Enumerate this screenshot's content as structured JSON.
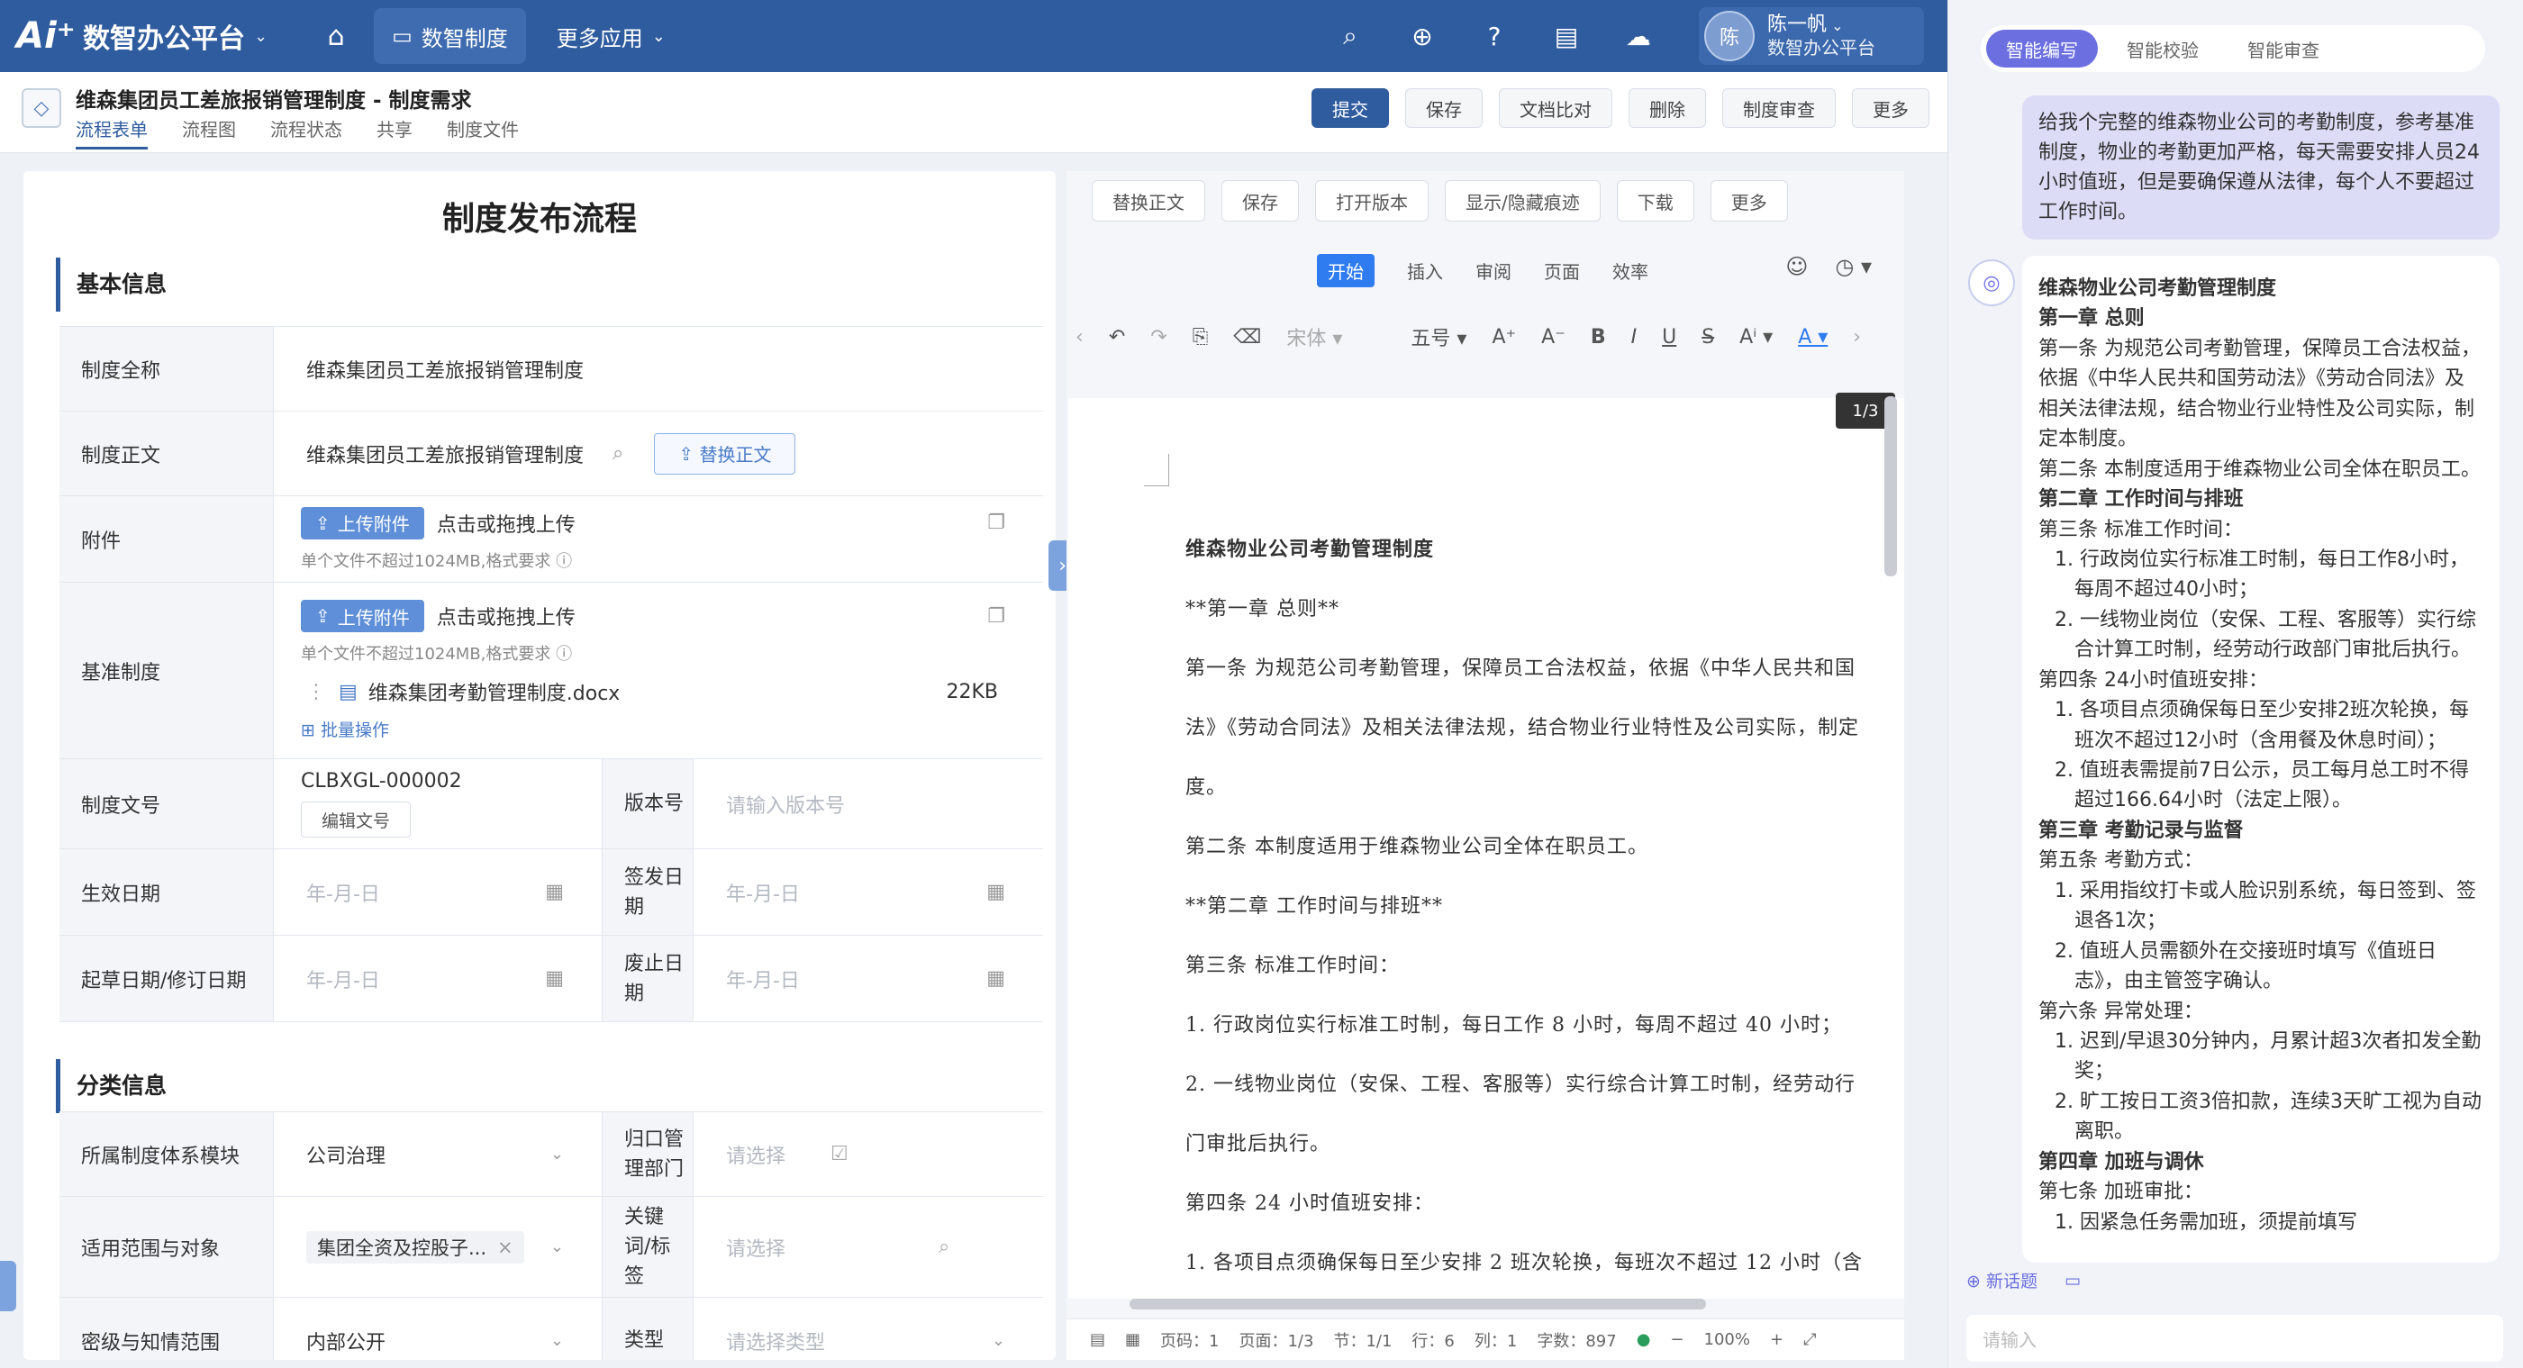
{
  "topbar": {
    "logo": "Ai⁺",
    "app_title": "数智办公平台",
    "nav_active": "数智制度",
    "nav_more": "更多应用",
    "user_avatar": "陈",
    "user_name": "陈一帆",
    "user_org": "数智办公平台"
  },
  "header": {
    "doc_title": "维森集团员工差旅报销管理制度 - 制度需求",
    "tabs": [
      "流程表单",
      "流程图",
      "流程状态",
      "共享",
      "制度文件"
    ],
    "buttons": [
      "提交",
      "保存",
      "文档比对",
      "删除",
      "制度审查",
      "更多"
    ]
  },
  "form": {
    "title": "制度发布流程",
    "section_basic": "基本信息",
    "section_category": "分类信息",
    "full_name_label": "制度全称",
    "full_name_value": "维森集团员工差旅报销管理制度",
    "body_label": "制度正文",
    "body_value": "维森集团员工差旅报销管理制度",
    "replace_body_btn": "替换正文",
    "attach_label": "附件",
    "upload_btn": "上传附件",
    "upload_text": "点击或拖拽上传",
    "upload_hint": "单个文件不超过1024MB,格式要求",
    "base_label": "基准制度",
    "base_file": "维森集团考勤管理制度.docx",
    "base_file_size": "22KB",
    "batch_op": "批量操作",
    "docno_label": "制度文号",
    "docno_value": "CLBXGL-000002",
    "edit_docno_btn": "编辑文号",
    "version_label": "版本号",
    "version_placeholder": "请输入版本号",
    "effective_label": "生效日期",
    "issue_label": "签发日期",
    "draft_label": "起草日期/修订日期",
    "abolish_label": "废止日期",
    "date_placeholder": "年-月-日",
    "module_label": "所属制度体系模块",
    "module_value": "公司治理",
    "dept_label": "归口管理部门",
    "select_placeholder": "请选择",
    "scope_label": "适用范围与对象",
    "scope_value": "集团全资及控股子...",
    "keyword_label": "关键词/标签",
    "secret_label": "密级与知情范围",
    "secret_value": "内部公开",
    "type_label": "类型",
    "type_placeholder": "请选择类型"
  },
  "doc": {
    "toolbar": [
      "替换正文",
      "保存",
      "打开版本",
      "显示/隐藏痕迹",
      "下载",
      "更多"
    ],
    "menu": [
      "开始",
      "插入",
      "审阅",
      "页面",
      "效率"
    ],
    "font_name": "宋体",
    "font_size": "五号",
    "page_badge": "1/3",
    "lines": [
      "维森物业公司考勤管理制度",
      "**第一章 总则**",
      "第一条 为规范公司考勤管理，保障员工合法权益，依据《中华人民共和国",
      "法》《劳动合同法》及相关法律法规，结合物业行业特性及公司实际，制定",
      "度。",
      "第二条 本制度适用于维森物业公司全体在职员工。",
      "**第二章 工作时间与排班**",
      "第三条 标准工作时间：",
      "1. 行政岗位实行标准工时制，每日工作 8 小时，每周不超过 40 小时；",
      "2. 一线物业岗位（安保、工程、客服等）实行综合计算工时制，经劳动行",
      "门审批后执行。",
      "第四条 24 小时值班安排：",
      "1. 各项目点须确保每日至少安排 2 班次轮换，每班次不超过 12 小时（含"
    ],
    "status": {
      "page_code": "页码：1",
      "page": "页面：1/3",
      "section": "节：1/1",
      "row": "行：6",
      "col": "列：1",
      "words": "字数：897",
      "zoom": "100%"
    }
  },
  "ai": {
    "tabs": [
      "智能编写",
      "智能校验",
      "智能审查"
    ],
    "user_message": "给我个完整的维森物业公司的考勤制度，参考基准制度，物业的考勤更加严格，每天需要安排人员24小时值班，但是要确保遵从法律，每个人不要超过工作时间。",
    "reply": [
      {
        "t": "b",
        "s": "维森物业公司考勤管理制度"
      },
      {
        "t": "b",
        "s": "第一章 总则"
      },
      {
        "t": "p",
        "s": "第一条 为规范公司考勤管理，保障员工合法权益，依据《中华人民共和国劳动法》《劳动合同法》及相关法律法规，结合物业行业特性及公司实际，制定本制度。"
      },
      {
        "t": "p",
        "s": "第二条 本制度适用于维森物业公司全体在职员工。"
      },
      {
        "t": "b",
        "s": "第二章 工作时间与排班"
      },
      {
        "t": "p",
        "s": "第三条 标准工作时间："
      },
      {
        "t": "li",
        "s": "1. 行政岗位实行标准工时制，每日工作8小时，每周不超过40小时；"
      },
      {
        "t": "li",
        "s": "2. 一线物业岗位（安保、工程、客服等）实行综合计算工时制，经劳动行政部门审批后执行。"
      },
      {
        "t": "p",
        "s": "第四条 24小时值班安排："
      },
      {
        "t": "li",
        "s": "1. 各项目点须确保每日至少安排2班次轮换，每班次不超过12小时（含用餐及休息时间）；"
      },
      {
        "t": "li",
        "s": "2. 值班表需提前7日公示，员工每月总工时不得超过166.64小时（法定上限）。"
      },
      {
        "t": "b",
        "s": "第三章 考勤记录与监督"
      },
      {
        "t": "p",
        "s": "第五条 考勤方式："
      },
      {
        "t": "li",
        "s": "1. 采用指纹打卡或人脸识别系统，每日签到、签退各1次；"
      },
      {
        "t": "li",
        "s": "2. 值班人员需额外在交接班时填写《值班日志》，由主管签字确认。"
      },
      {
        "t": "p",
        "s": "第六条 异常处理："
      },
      {
        "t": "li",
        "s": "1. 迟到/早退30分钟内，月累计超3次者扣发全勤奖；"
      },
      {
        "t": "li",
        "s": "2. 旷工按日工资3倍扣款，连续3天旷工视为自动离职。"
      },
      {
        "t": "b",
        "s": "第四章 加班与调休"
      },
      {
        "t": "p",
        "s": "第七条 加班审批："
      },
      {
        "t": "li",
        "s": "1. 因紧急任务需加班，须提前填写"
      }
    ],
    "new_topic": "新话题",
    "input_placeholder": "请输入"
  }
}
